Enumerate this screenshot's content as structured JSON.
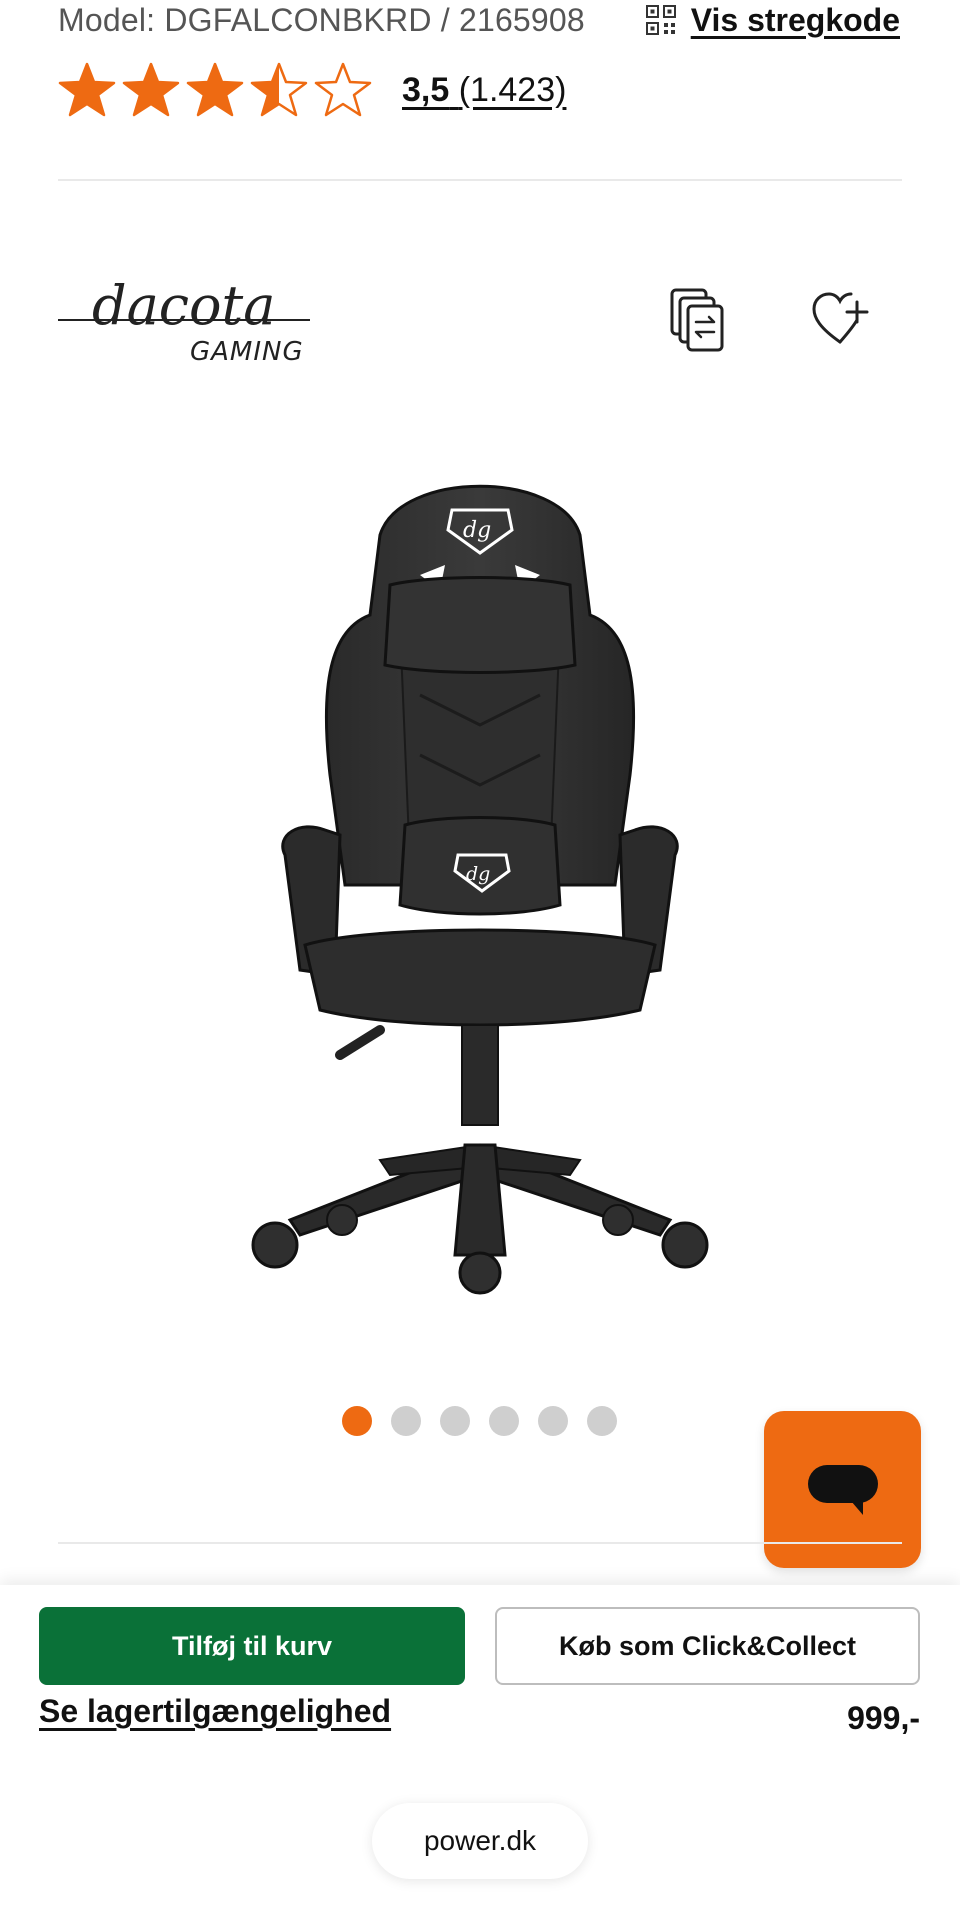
{
  "product": {
    "model_text": "Model: DGFALCONBKRD / 2165908",
    "barcode_label": "Vis stregkode",
    "rating_value": "3,5",
    "rating_count": "(1.423)",
    "stars": 3.5,
    "brand_name": "dacota",
    "brand_sub": "GAMING"
  },
  "carousel": {
    "total": 6,
    "active_index": 0
  },
  "actions": {
    "add_to_cart": "Tilføj til kurv",
    "click_collect": "Køb som Click&Collect",
    "stock_link": "Se lagertilgængelighed",
    "price": "999,-"
  },
  "browser": {
    "url": "power.dk"
  },
  "colors": {
    "accent": "#ee6a12",
    "cart_green": "#0a7138",
    "dot_inactive": "#cfcfcf"
  },
  "icons": [
    "qr-code-icon",
    "star-icon",
    "compare-icon",
    "heart-plus-icon",
    "chat-icon"
  ]
}
